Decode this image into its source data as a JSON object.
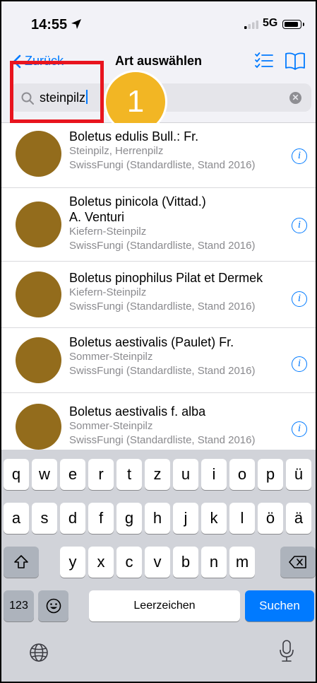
{
  "status_bar": {
    "time": "14:55",
    "network": "5G"
  },
  "nav": {
    "back_label": "Zurück",
    "title": "Art auswählen"
  },
  "search": {
    "value": "steinpilz",
    "placeholder": ""
  },
  "annotation": {
    "step_number": "1"
  },
  "results": [
    {
      "name_line1": "Boletus edulis Bull.: Fr.",
      "name_line2": "",
      "common": "Steinpilz, Herrenpilz",
      "source": "SwissFungi (Standardliste, Stand 2016)"
    },
    {
      "name_line1": "Boletus pinicola (Vittad.)",
      "name_line2": "A. Venturi",
      "common": "Kiefern-Steinpilz",
      "source": "SwissFungi (Standardliste, Stand 2016)"
    },
    {
      "name_line1": "Boletus pinophilus Pilat et Dermek",
      "name_line2": "",
      "common": "Kiefern-Steinpilz",
      "source": "SwissFungi (Standardliste, Stand 2016)"
    },
    {
      "name_line1": "Boletus aestivalis (Paulet) Fr.",
      "name_line2": "",
      "common": "Sommer-Steinpilz",
      "source": "SwissFungi (Standardliste, Stand 2016)"
    },
    {
      "name_line1": "Boletus aestivalis f. alba",
      "name_line2": "",
      "common": "Sommer-Steinpilz",
      "source": "SwissFungi (Standardliste, Stand 2016)"
    }
  ],
  "keyboard": {
    "row1": [
      "q",
      "w",
      "e",
      "r",
      "t",
      "z",
      "u",
      "i",
      "o",
      "p",
      "ü"
    ],
    "row2": [
      "a",
      "s",
      "d",
      "f",
      "g",
      "h",
      "j",
      "k",
      "l",
      "ö",
      "ä"
    ],
    "row3": [
      "y",
      "x",
      "c",
      "v",
      "b",
      "n",
      "m"
    ],
    "numbers_label": "123",
    "space_label": "Leerzeichen",
    "search_label": "Suchen"
  },
  "colors": {
    "accent": "#007aff",
    "avatar": "#936c1c",
    "highlight": "#e8141e",
    "badge": "#f2b624"
  }
}
